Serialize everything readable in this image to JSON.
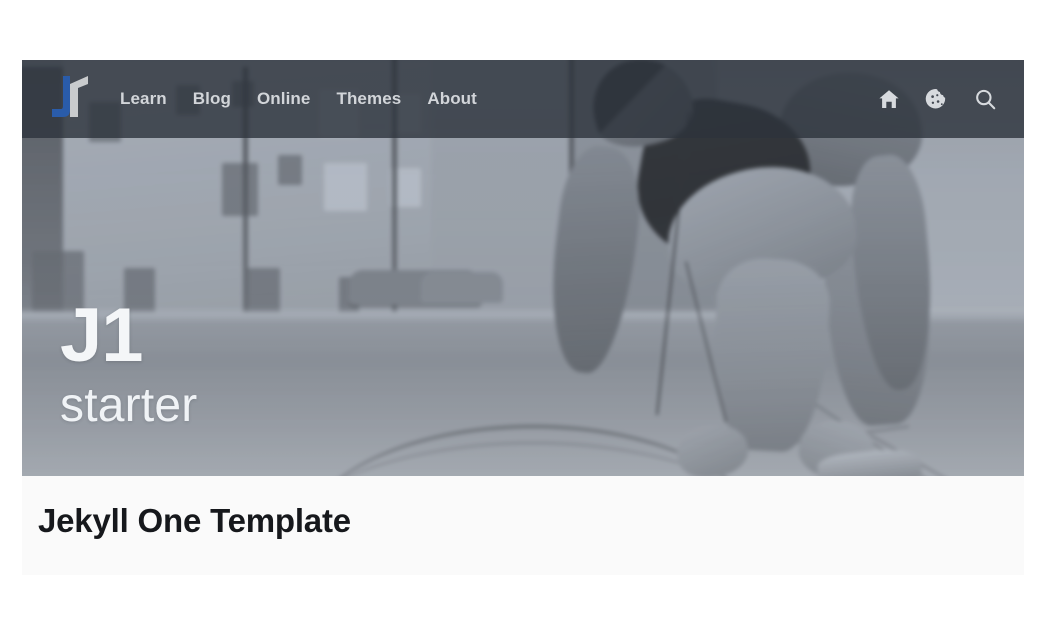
{
  "site": {
    "title": "J1 starter",
    "accent_color": "#2a5caa",
    "navbar_bg": "rgba(45,51,60,0.80)",
    "panel_bg": "#fafafa"
  },
  "navbar": {
    "brand": {
      "name": "J1",
      "icon": "j1-logo-icon",
      "blue": "#2a5caa",
      "gray": "#c9cbcd"
    },
    "links": [
      {
        "label": "Learn",
        "name": "nav-link-learn"
      },
      {
        "label": "Blog",
        "name": "nav-link-blog"
      },
      {
        "label": "Online",
        "name": "nav-link-online"
      },
      {
        "label": "Themes",
        "name": "nav-link-themes"
      },
      {
        "label": "About",
        "name": "nav-link-about"
      }
    ],
    "icons": [
      {
        "label": "Home",
        "icon": "home-icon"
      },
      {
        "label": "Cookie",
        "icon": "cookie-icon"
      },
      {
        "label": "Search",
        "icon": "search-icon"
      }
    ]
  },
  "hero": {
    "title": "J1",
    "subtitle": "starter",
    "image_alt": "runner crouching to tie shoe on a city street"
  },
  "content": {
    "heading": "Jekyll One Template"
  }
}
